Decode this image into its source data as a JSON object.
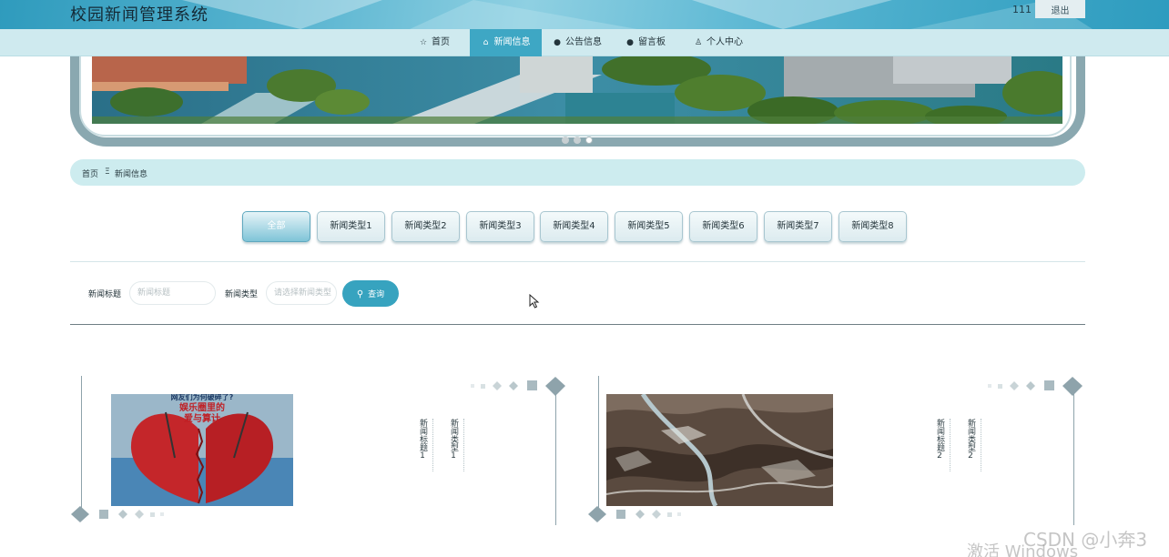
{
  "header": {
    "title": "校园新闻管理系统",
    "username": "111",
    "logout_label": "退出"
  },
  "nav": {
    "items": [
      {
        "label": "首页",
        "icon": "star-icon"
      },
      {
        "label": "新闻信息",
        "icon": "home-icon"
      },
      {
        "label": "公告信息",
        "icon": "info-icon"
      },
      {
        "label": "留言板",
        "icon": "help-icon"
      },
      {
        "label": "个人中心",
        "icon": "user-icon"
      }
    ],
    "active_index": 1
  },
  "banner": {
    "image": "campus-aerial-photo",
    "slide_count": 3,
    "active_slide": 3
  },
  "breadcrumb": {
    "home": "首页",
    "separator": "Ξ",
    "current": "新闻信息"
  },
  "categories": {
    "items": [
      "全部",
      "新闻类型1",
      "新闻类型2",
      "新闻类型3",
      "新闻类型4",
      "新闻类型5",
      "新闻类型6",
      "新闻类型7",
      "新闻类型8"
    ],
    "active_index": 0
  },
  "search": {
    "title_label": "新闻标题",
    "title_placeholder": "新闻标题",
    "type_label": "新闻类型",
    "type_placeholder": "请选择新闻类型",
    "button_label": "查询"
  },
  "news": [
    {
      "title": "新闻标题1",
      "type": "新闻类型1",
      "image": "broken-heart-apple-cover",
      "image_caption": "娱乐圈里的爱与算计",
      "image_subcaption": "网友们为何破碎了?"
    },
    {
      "title": "新闻标题2",
      "type": "新闻类型2",
      "image": "satellite-terrain-photo"
    }
  ],
  "watermarks": {
    "csdn": "CSDN @小奔3",
    "windows": "激活 Windows"
  },
  "colors": {
    "accent": "#3ea7c4",
    "nav_bg": "#cfeaef",
    "breadcrumb_bg": "#cdecef",
    "frame": "#8aa8b0"
  }
}
